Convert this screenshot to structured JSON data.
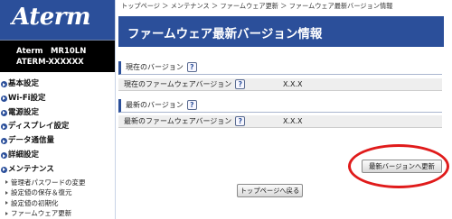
{
  "brand": {
    "logo": "Aterm"
  },
  "device": {
    "line1": "Aterm　MR10LN",
    "line2": "ATERM-XXXXXX"
  },
  "menu": [
    {
      "label": "基本設定",
      "icon": "circle-arrow-icon"
    },
    {
      "label": "Wi-Fi設定",
      "icon": "circle-arrow-icon"
    },
    {
      "label": "電源設定",
      "icon": "circle-arrow-icon"
    },
    {
      "label": "ディスプレイ設定",
      "icon": "circle-arrow-icon"
    },
    {
      "label": "データ通信量",
      "icon": "circle-arrow-icon"
    },
    {
      "label": "詳細設定",
      "icon": "circle-arrow-icon"
    },
    {
      "label": "メンテナンス",
      "icon": "circle-arrow-icon"
    }
  ],
  "submenu": [
    {
      "label": "管理者パスワードの変更"
    },
    {
      "label": "設定値の保存＆復元"
    },
    {
      "label": "設定値の初期化"
    },
    {
      "label": "ファームウェア更新"
    }
  ],
  "breadcrumb": "トップページ ＞ メンテナンス ＞ ファームウェア更新 ＞ ファームウェア最新バージョン情報",
  "page_title": "ファームウェア最新バージョン情報",
  "sections": {
    "current": {
      "heading": "現在のバージョン",
      "row_label": "現在のファームウェアバージョン",
      "row_value": "X.X.X"
    },
    "latest": {
      "heading": "最新のバージョン",
      "row_label": "最新のファームウェアバージョン",
      "row_value": "X.X.X"
    }
  },
  "help_mark": "?",
  "buttons": {
    "update": "最新バージョンへ更新",
    "back": "トップページへ戻る"
  },
  "colors": {
    "brand_blue": "#2b4f9a",
    "highlight_red": "#e01b1b",
    "sidebar_black": "#000000"
  }
}
